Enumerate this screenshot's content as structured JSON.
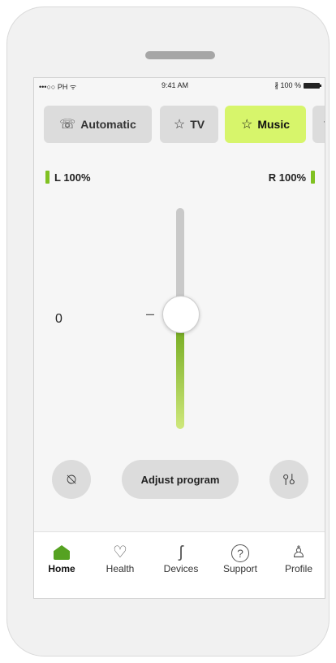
{
  "status_bar": {
    "carrier": "•••○○ PH ᯤ",
    "time": "9:41 AM",
    "battery": "∦ 100 %"
  },
  "programs": [
    {
      "label": "Automatic",
      "icon": "ear-waves-icon",
      "glyph": "☏",
      "active": false
    },
    {
      "label": "TV",
      "icon": "star-icon",
      "glyph": "☆",
      "active": false
    },
    {
      "label": "Music",
      "icon": "star-icon",
      "glyph": "☆",
      "active": true
    },
    {
      "label": "",
      "icon": "partial-icon",
      "glyph": "ɤ",
      "active": false
    }
  ],
  "battery_levels": {
    "left": "L 100%",
    "right": "R 100%",
    "color": "#80c121"
  },
  "volume": {
    "value": "0",
    "minus_symbol": "–",
    "level": 0.5
  },
  "controls": {
    "mute_icon": "speaker-muted-icon",
    "mute_glyph": "⍉",
    "adjust_label": "Adjust program",
    "equalizer_icon": "sliders-icon",
    "equalizer_glyph": "⫯⫰"
  },
  "tabs": [
    {
      "label": "Home",
      "icon": "home-icon",
      "active": true
    },
    {
      "label": "Health",
      "icon": "heart-icon",
      "glyph": "♡",
      "active": false
    },
    {
      "label": "Devices",
      "icon": "hearing-aid-icon",
      "glyph": "ʃ",
      "active": false
    },
    {
      "label": "Support",
      "icon": "question-icon",
      "glyph": "?",
      "active": false
    },
    {
      "label": "Profile",
      "icon": "person-icon",
      "glyph": "♙",
      "active": false
    }
  ],
  "accent_color": "#d7f56b",
  "active_tab_color": "#55a221"
}
